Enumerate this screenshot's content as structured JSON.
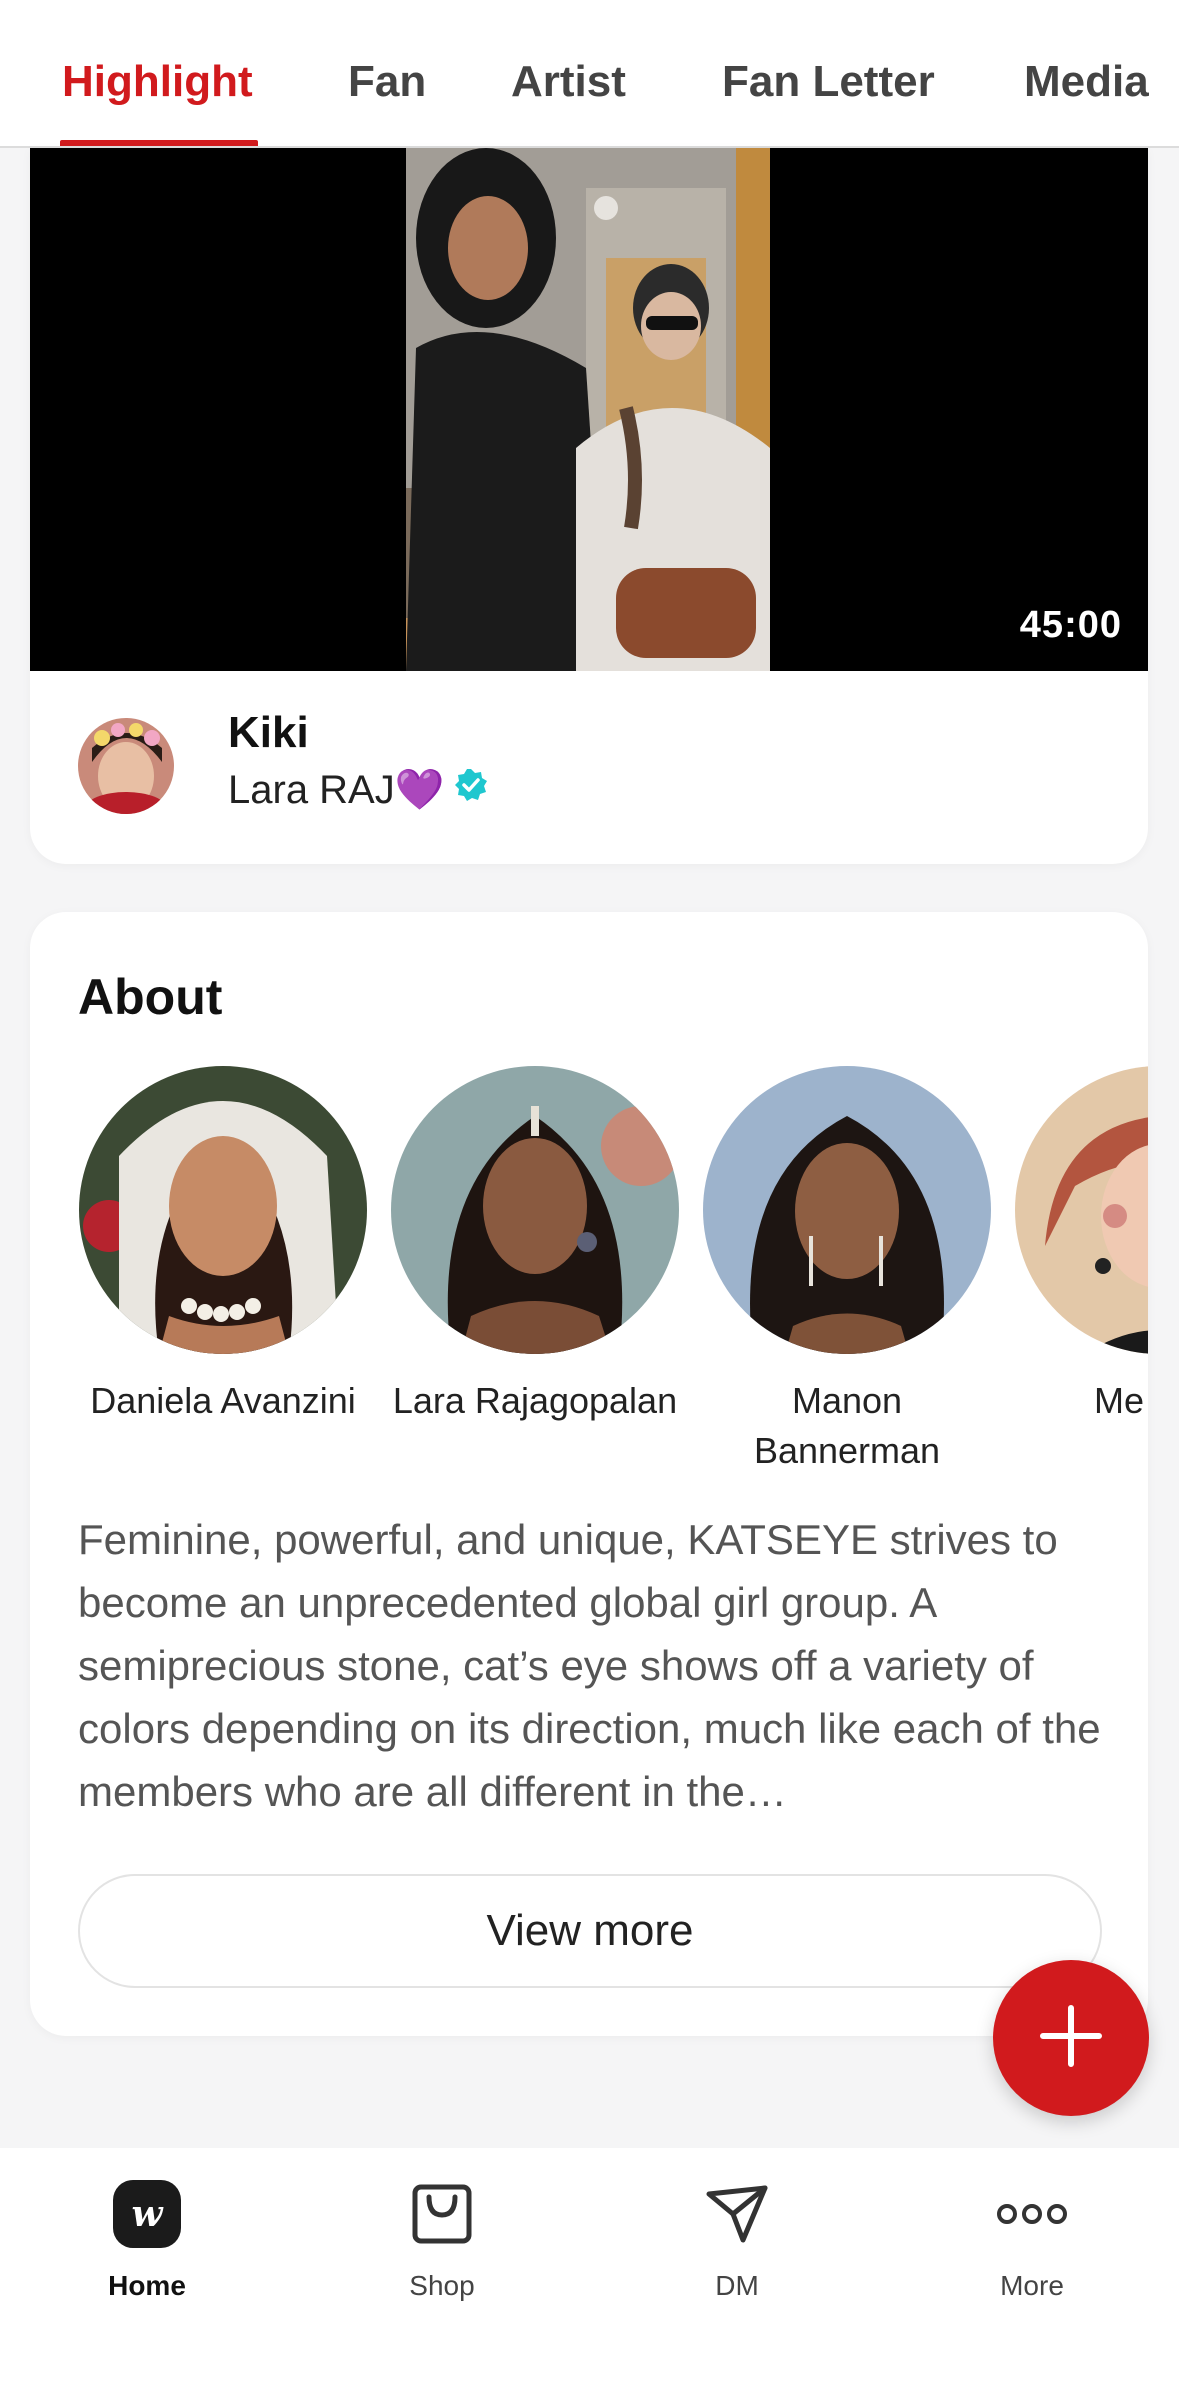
{
  "tabs": [
    {
      "label": "Highlight",
      "active": true
    },
    {
      "label": "Fan",
      "active": false
    },
    {
      "label": "Artist",
      "active": false
    },
    {
      "label": "Fan Letter",
      "active": false
    },
    {
      "label": "Media",
      "active": false
    }
  ],
  "video": {
    "duration": "45:00",
    "poster_name": "Kiki",
    "poster_subtitle": "Lara RAJ💜",
    "verified_icon": "verified-badge-icon"
  },
  "about": {
    "title": "About",
    "members": [
      {
        "name": "Daniela Avanzini"
      },
      {
        "name": "Lara Rajagopalan"
      },
      {
        "name": "Manon Bannerman"
      },
      {
        "name": "Me Skie"
      }
    ],
    "description": "Feminine, powerful, and unique, KATSEYE strives to become an unprecedented global girl group. A semiprecious stone, cat’s eye shows off a variety of colors depending on its direction, much like each of the members who are all different in the…",
    "view_more_label": "View more"
  },
  "fab_icon": "plus-icon",
  "bottom_nav": [
    {
      "label": "Home",
      "icon": "weverse-home-icon",
      "active": true
    },
    {
      "label": "Shop",
      "icon": "shopping-bag-icon",
      "active": false
    },
    {
      "label": "DM",
      "icon": "paper-plane-icon",
      "active": false
    },
    {
      "label": "More",
      "icon": "more-dots-icon",
      "active": false
    }
  ],
  "colors": {
    "accent": "#d11a1d",
    "verified": "#1fc7cf",
    "background": "#f5f5f6"
  }
}
